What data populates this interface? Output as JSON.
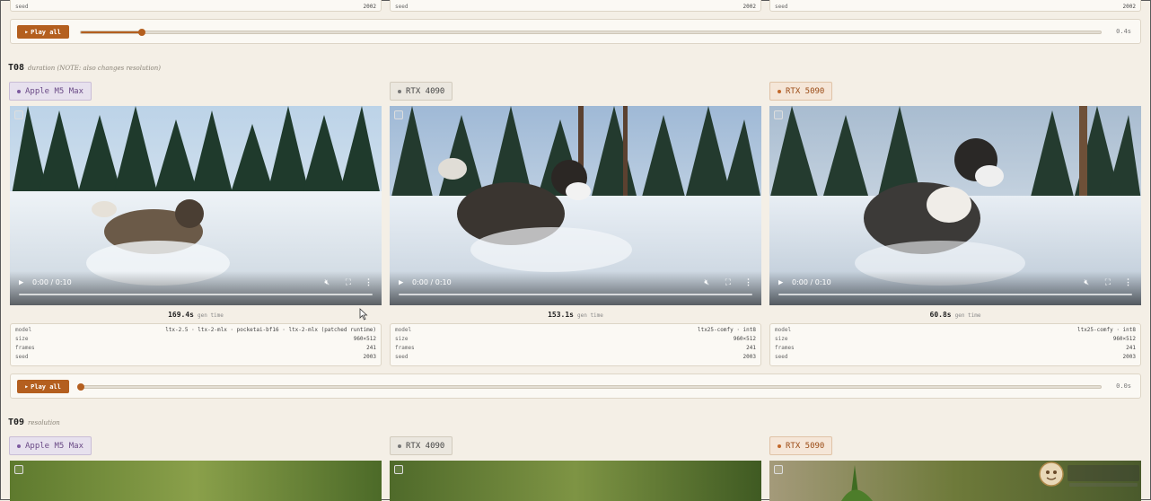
{
  "prev_row": {
    "cards": [
      {
        "seed_label": "seed",
        "seed_value": "2002"
      },
      {
        "seed_label": "seed",
        "seed_value": "2002"
      },
      {
        "seed_label": "seed",
        "seed_value": "2002"
      }
    ],
    "player": {
      "play_label": "Play all",
      "time": "0.4s",
      "progress": 0.06
    }
  },
  "sections": [
    {
      "id": "T08",
      "note": "duration (NOTE: also changes resolution)",
      "columns": [
        {
          "device": "Apple M5 Max",
          "video_time": "0:00 / 0:10",
          "gen_time": "169.4s",
          "gen_label": "gen time",
          "model_label": "model",
          "model": "ltx-2.5 · ltx-2-mlx · pocketai-bf16 · ltx-2-mlx (patched runtime)",
          "size_label": "size",
          "size": "960×512",
          "frames_label": "frames",
          "frames": "241",
          "seed_label": "seed",
          "seed": "2003"
        },
        {
          "device": "RTX 4090",
          "video_time": "0:00 / 0:10",
          "gen_time": "153.1s",
          "gen_label": "gen time",
          "model_label": "model",
          "model": "ltx25-comfy · int8",
          "size_label": "size",
          "size": "960×512",
          "frames_label": "frames",
          "frames": "241",
          "seed_label": "seed",
          "seed": "2003"
        },
        {
          "device": "RTX 5090",
          "video_time": "0:00 / 0:10",
          "gen_time": "60.8s",
          "gen_label": "gen time",
          "model_label": "model",
          "model": "ltx25-comfy · int8",
          "size_label": "size",
          "size": "960×512",
          "frames_label": "frames",
          "frames": "241",
          "seed_label": "seed",
          "seed": "2003"
        }
      ],
      "player": {
        "play_label": "Play all",
        "time": "0.0s",
        "progress": 0.0
      }
    },
    {
      "id": "T09",
      "note": "resolution",
      "columns": [
        {
          "device": "Apple M5 Max"
        },
        {
          "device": "RTX 4090"
        },
        {
          "device": "RTX 5090"
        }
      ]
    }
  ],
  "icons": {
    "play": "play-icon",
    "mute": "volume-muted-icon",
    "fullscreen": "fullscreen-icon",
    "more": "more-vertical-icon"
  },
  "colors": {
    "accent": "#b45f1f",
    "background": "#f4efe6",
    "apple_tag": "#6a4a86",
    "rtx5090_tag": "#9a4a14"
  }
}
